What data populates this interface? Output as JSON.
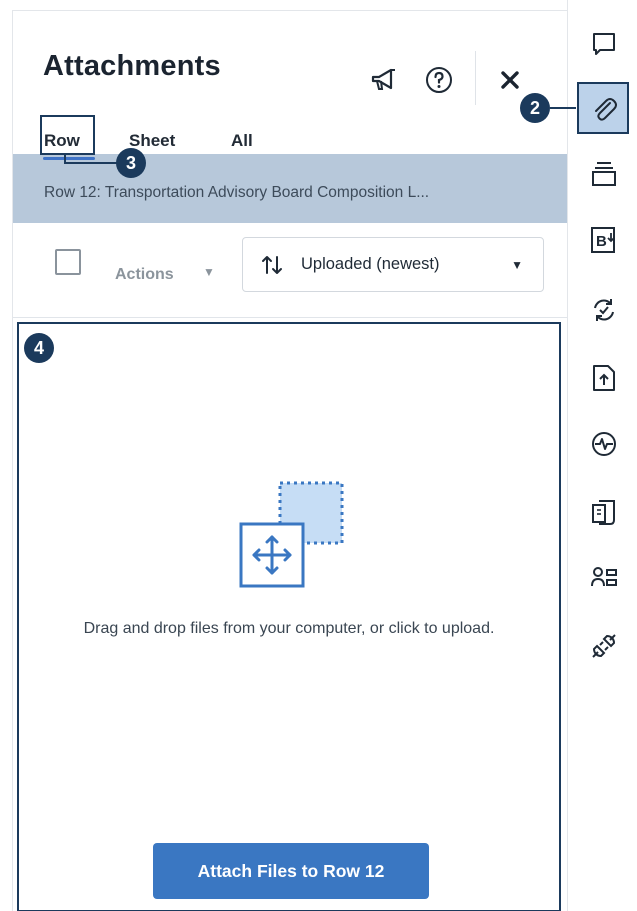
{
  "panel": {
    "title": "Attachments",
    "tabs": [
      {
        "label": "Row",
        "active": true
      },
      {
        "label": "Sheet",
        "active": false
      },
      {
        "label": "All",
        "active": false
      }
    ],
    "row_banner": "Row 12: Transportation Advisory Board Composition L...",
    "toolbar": {
      "actions_label": "Actions",
      "sort_label": "Uploaded (newest)"
    },
    "dropzone": {
      "instruction": "Drag and drop files from your computer, or click to upload.",
      "attach_button": "Attach Files to Row 12"
    },
    "header_icons": [
      "megaphone-icon",
      "help-icon",
      "close-icon"
    ]
  },
  "rail_icons": [
    "comment-icon",
    "attachment-icon",
    "card-stack-icon",
    "bold-download-icon",
    "refresh-icon",
    "file-upload-icon",
    "activity-icon",
    "document-copy-icon",
    "contact-list-icon",
    "connector-plug-icon"
  ],
  "badges": {
    "two": "2",
    "three": "3",
    "four": "4"
  },
  "colors": {
    "accent": "#3a77c2",
    "banner": "#b7c8da",
    "callout": "#1b3a5c",
    "rail_active": "#bcd2ea"
  }
}
